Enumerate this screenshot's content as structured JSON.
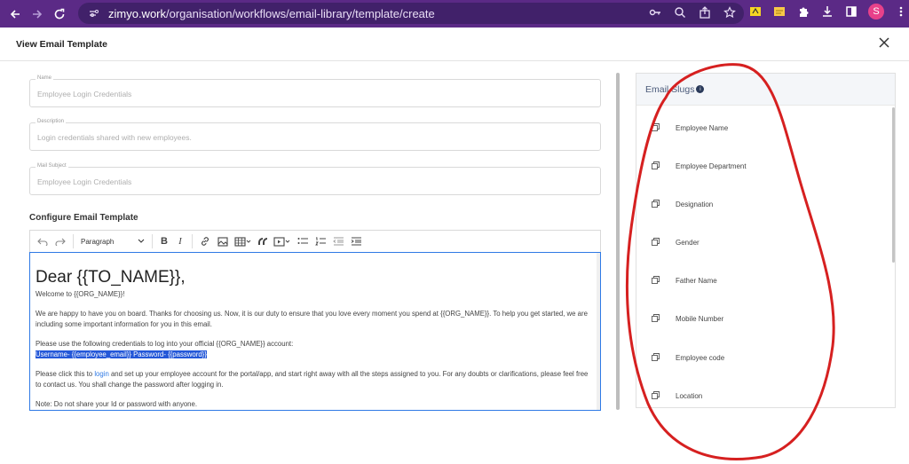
{
  "browser": {
    "url_host": "zimyo.work",
    "url_path": "/organisation/workflows/email-library/template/create",
    "profile_initial": "S"
  },
  "header": {
    "title": "View Email Template",
    "close_icon": "close-icon"
  },
  "form": {
    "name": {
      "label": "Name",
      "value": "Employee Login Credentials"
    },
    "description": {
      "label": "Description",
      "value": "Login credentials shared with new employees."
    },
    "mail_subject": {
      "label": "Mail Subject",
      "value": "Employee Login Credentials"
    }
  },
  "editor_section": {
    "title": "Configure Email Template",
    "toolbar": {
      "paragraph": "Paragraph"
    },
    "content": {
      "heading": "Dear {{TO_NAME}},",
      "p1": "Welcome to {{ORG_NAME}}!",
      "p2": "We are happy to have you on board. Thanks for choosing us. Now, it is our duty to ensure that you love every moment you spend at {{ORG_NAME}}. To help you get started, we are including some important information for you in this email.",
      "p3": "Please use the following credentials to log into your official {{ORG_NAME}} account:",
      "p3_highlight": "Username- {{employee_email}} Password- {{password}}",
      "p4_before": "Please click this to ",
      "p4_link": "login",
      "p4_after": " and set up your employee account for the portal/app, and start right away with all the steps assigned to you. For any doubts or clarifications, please feel free to contact us. You shall change the password after logging in.",
      "p5": "Note: Do not share your Id or password with anyone."
    }
  },
  "slugs": {
    "title": "Email Slugs",
    "info": "i",
    "items": [
      "Employee Name",
      "Employee Department",
      "Designation",
      "Gender",
      "Father Name",
      "Mobile Number",
      "Employee code",
      "Location"
    ]
  },
  "colors": {
    "chrome": "#5b2a86",
    "accent": "#2f7ae5",
    "highlight": "#2357d8",
    "annotation": "#d62020"
  }
}
